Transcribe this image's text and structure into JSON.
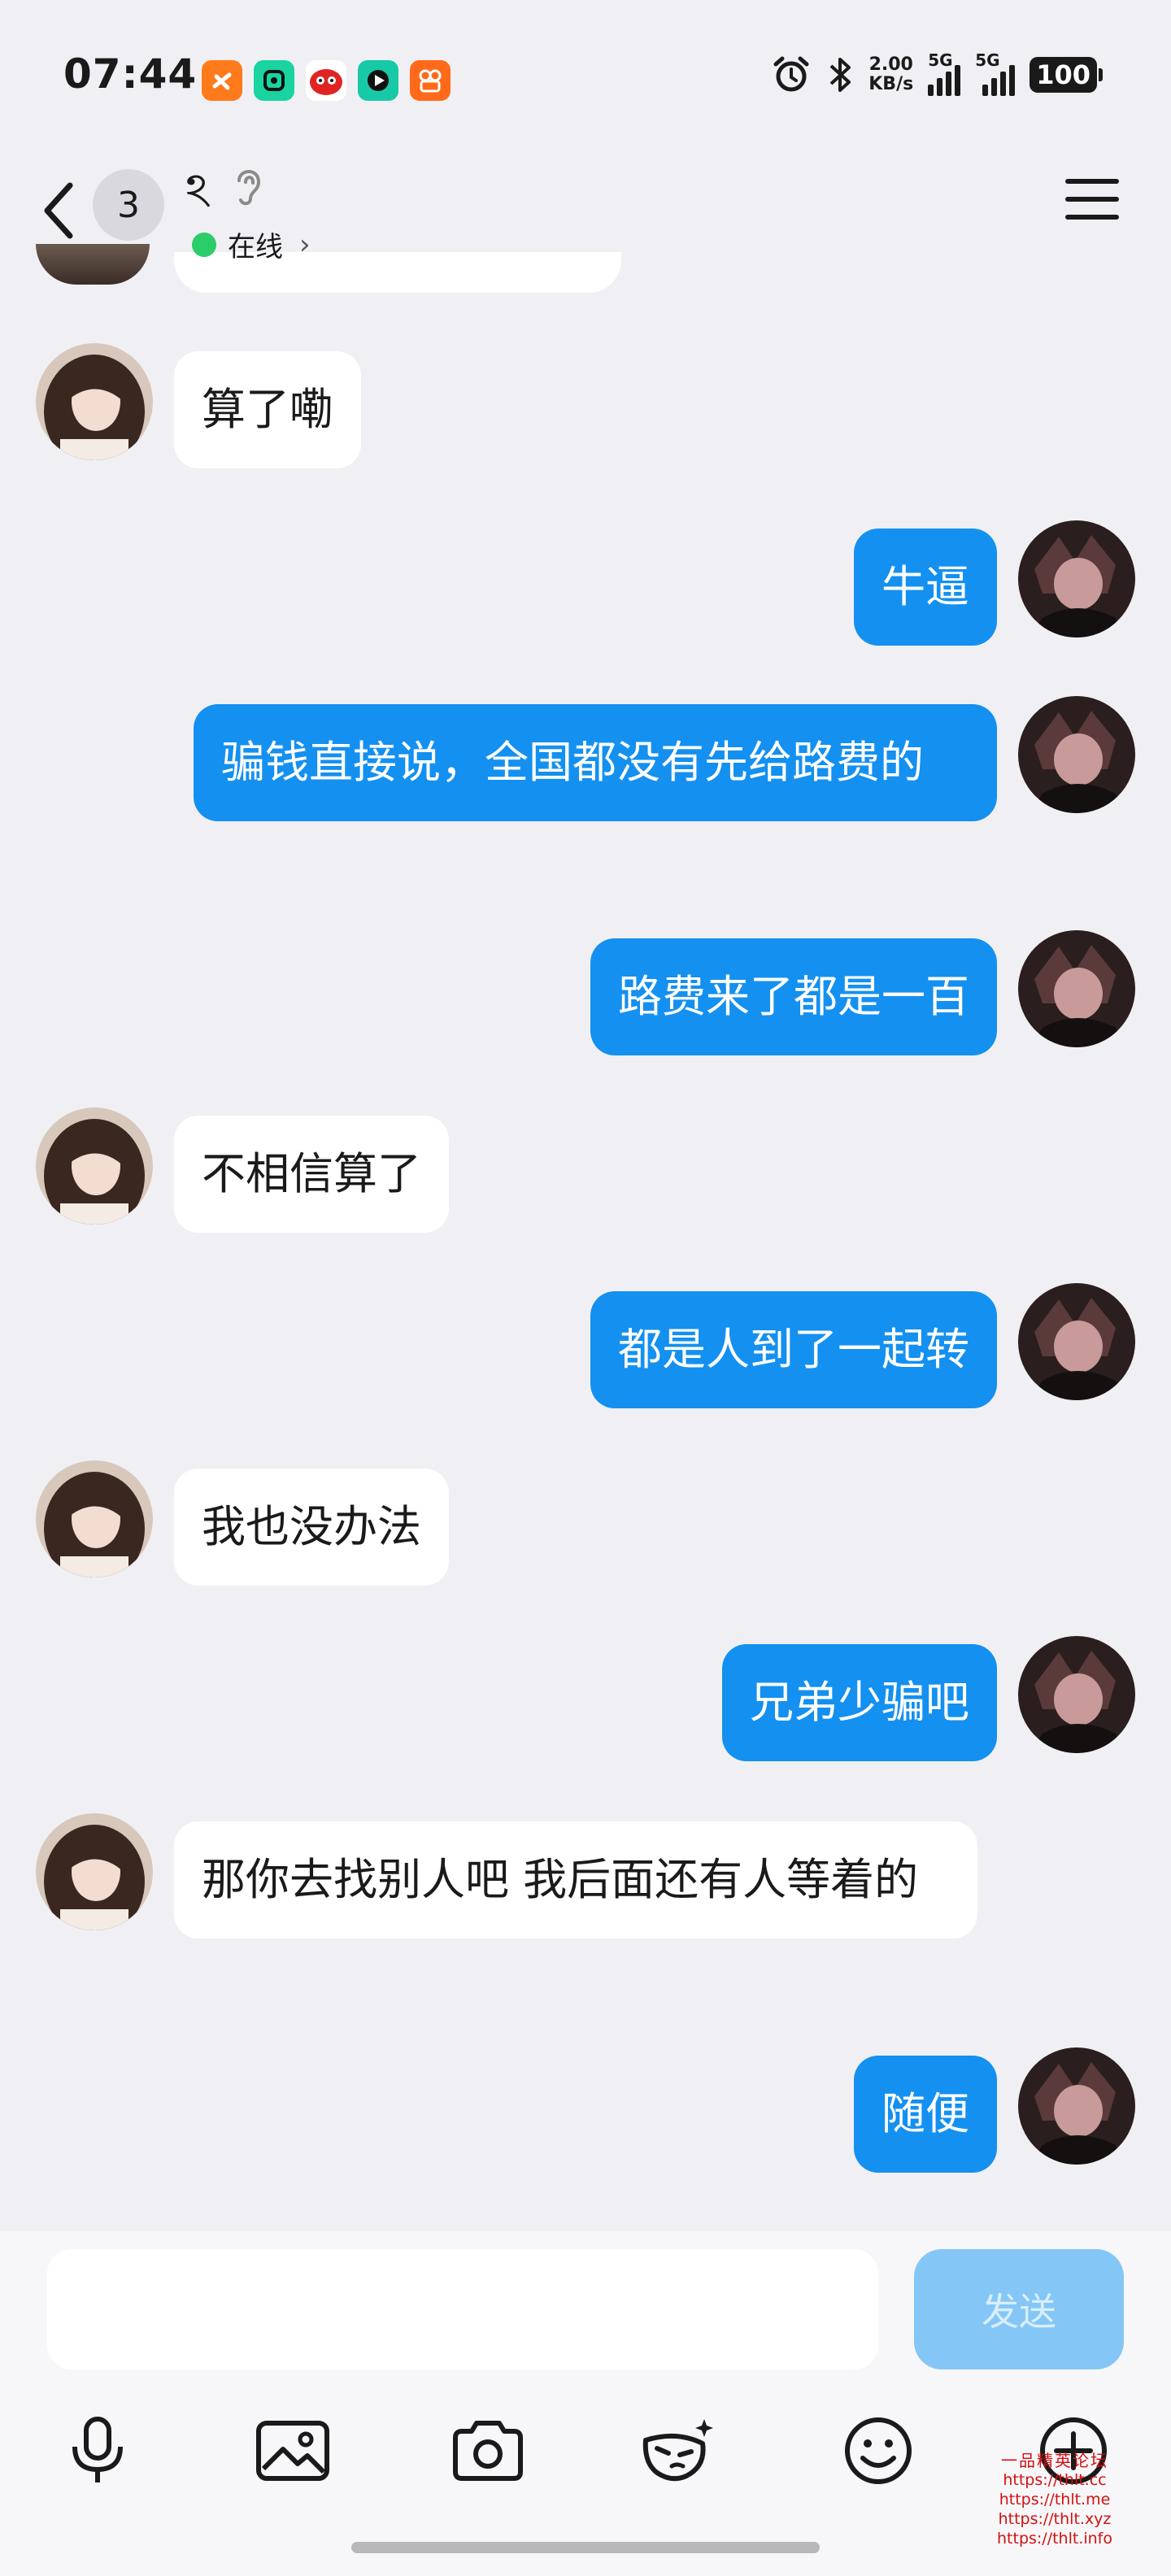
{
  "status_bar": {
    "time": "07:44",
    "net_speed_value": "2.00",
    "net_speed_unit": "KB/s",
    "sim1_label": "5G",
    "sim2_label": "5G",
    "battery": "100",
    "app_icons": [
      "taobao-icon",
      "wechat-mini-icon",
      "red-app-icon",
      "video-app-icon",
      "kuaishou-icon"
    ]
  },
  "header": {
    "unread_count": "3",
    "contact_name": "ঽ",
    "status_text": "在线",
    "status_color": "#2bcc6a"
  },
  "messages": [
    {
      "side": "left",
      "text": "算了嘞"
    },
    {
      "side": "right",
      "text": "牛逼"
    },
    {
      "side": "right",
      "text": "骗钱直接说，全国都没有先给路费的"
    },
    {
      "side": "right",
      "text": "路费来了都是一百"
    },
    {
      "side": "left",
      "text": "不相信算了"
    },
    {
      "side": "right",
      "text": "都是人到了一起转"
    },
    {
      "side": "left",
      "text": "我也没办法"
    },
    {
      "side": "right",
      "text": "兄弟少骗吧"
    },
    {
      "side": "left",
      "text": "那你去找别人吧 我后面还有人等着的"
    },
    {
      "side": "right",
      "text": "随便"
    }
  ],
  "composer": {
    "input_value": "",
    "send_label": "发送"
  },
  "toolbar": {
    "icons": [
      "microphone-icon",
      "image-icon",
      "camera-icon",
      "mask-icon",
      "emoji-icon",
      "plus-icon"
    ]
  },
  "watermark": {
    "title": "一品精英论坛",
    "lines": [
      "https://thlt.cc",
      "https://thlt.me",
      "https://thlt.xyz",
      "https://thlt.info"
    ]
  },
  "colors": {
    "sent_bubble": "#1490f0",
    "received_bubble": "#ffffff",
    "background": "#f0f0f4"
  }
}
